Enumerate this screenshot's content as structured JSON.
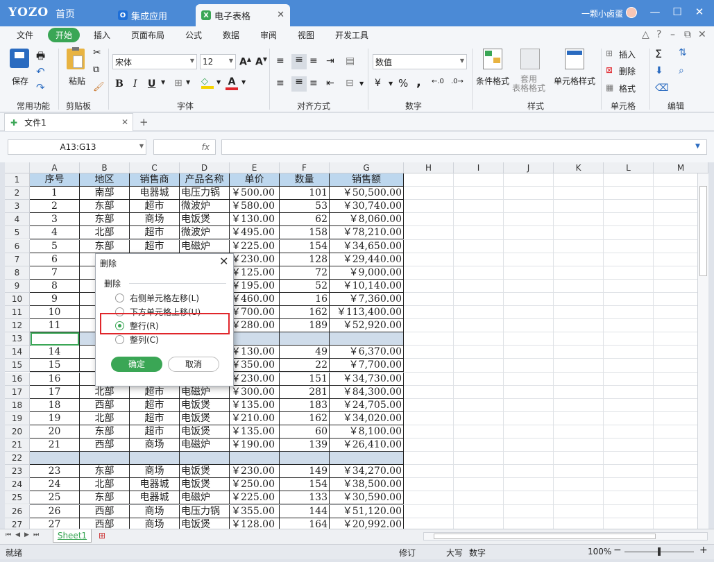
{
  "app": {
    "logo": "YOZO",
    "home": "首页",
    "tabs": [
      {
        "label": "集成应用",
        "icon": "O"
      },
      {
        "label": "电子表格",
        "icon": "X"
      }
    ],
    "user": "一颗小卤蛋"
  },
  "ribbon_tabs": [
    "文件",
    "开始",
    "插入",
    "页面布局",
    "公式",
    "数据",
    "审阅",
    "视图",
    "开发工具"
  ],
  "ribbon": {
    "save": "保存",
    "paste": "粘贴",
    "font_name": "宋体",
    "font_size": "12",
    "number_format": "数值",
    "cond_format": "条件格式",
    "table_format": "套用\n表格格式",
    "cell_style": "单元格样式",
    "insert": "插入",
    "delete": "删除",
    "format": "格式",
    "groups": [
      "常用功能",
      "剪贴板",
      "字体",
      "对齐方式",
      "数字",
      "样式",
      "单元格",
      "编辑"
    ],
    "bold": "B",
    "italic": "I",
    "underline": "U",
    "font_color_letter": "A",
    "currency": "¥",
    "percent": "%",
    "comma": ","
  },
  "doc_tab": "文件1",
  "formula_bar": {
    "name_box": "A13:G13",
    "fx": "fx",
    "content": ""
  },
  "columns": [
    "A",
    "B",
    "C",
    "D",
    "E",
    "F",
    "G",
    "H",
    "I",
    "J",
    "K",
    "L",
    "M"
  ],
  "headers": [
    "序号",
    "地区",
    "销售商",
    "产品名称",
    "单价",
    "数量",
    "销售额"
  ],
  "rows": [
    [
      "1",
      "南部",
      "电器城",
      "电压力锅",
      "￥500.00",
      "101",
      "￥50,500.00"
    ],
    [
      "2",
      "东部",
      "超市",
      "微波炉",
      "￥580.00",
      "53",
      "￥30,740.00"
    ],
    [
      "3",
      "东部",
      "商场",
      "电饭煲",
      "￥130.00",
      "62",
      "￥8,060.00"
    ],
    [
      "4",
      "北部",
      "超市",
      "微波炉",
      "￥495.00",
      "158",
      "￥78,210.00"
    ],
    [
      "5",
      "东部",
      "超市",
      "电磁炉",
      "￥225.00",
      "154",
      "￥34,650.00"
    ],
    [
      "6",
      "",
      "",
      "",
      "￥230.00",
      "128",
      "￥29,440.00"
    ],
    [
      "7",
      "",
      "",
      "",
      "￥125.00",
      "72",
      "￥9,000.00"
    ],
    [
      "8",
      "",
      "",
      "",
      "￥195.00",
      "52",
      "￥10,140.00"
    ],
    [
      "9",
      "",
      "",
      "",
      "￥460.00",
      "16",
      "￥7,360.00"
    ],
    [
      "10",
      "",
      "",
      "",
      "￥700.00",
      "162",
      "￥113,400.00"
    ],
    [
      "11",
      "",
      "",
      "",
      "￥280.00",
      "189",
      "￥52,920.00"
    ],
    [
      "",
      "",
      "",
      "",
      "",
      "",
      ""
    ],
    [
      "14",
      "",
      "",
      "",
      "￥130.00",
      "49",
      "￥6,370.00"
    ],
    [
      "15",
      "",
      "",
      "",
      "￥350.00",
      "22",
      "￥7,700.00"
    ],
    [
      "16",
      "",
      "",
      "",
      "￥230.00",
      "151",
      "￥34,730.00"
    ],
    [
      "17",
      "北部",
      "超市",
      "电磁炉",
      "￥300.00",
      "281",
      "￥84,300.00"
    ],
    [
      "18",
      "西部",
      "超市",
      "电饭煲",
      "￥135.00",
      "183",
      "￥24,705.00"
    ],
    [
      "19",
      "北部",
      "超市",
      "电饭煲",
      "￥210.00",
      "162",
      "￥34,020.00"
    ],
    [
      "20",
      "东部",
      "超市",
      "电饭煲",
      "￥135.00",
      "60",
      "￥8,100.00"
    ],
    [
      "21",
      "西部",
      "商场",
      "电磁炉",
      "￥190.00",
      "139",
      "￥26,410.00"
    ],
    [
      "",
      "",
      "",
      "",
      "",
      "",
      ""
    ],
    [
      "23",
      "东部",
      "商场",
      "电饭煲",
      "￥230.00",
      "149",
      "￥34,270.00"
    ],
    [
      "24",
      "北部",
      "电器城",
      "电饭煲",
      "￥250.00",
      "154",
      "￥38,500.00"
    ],
    [
      "25",
      "东部",
      "电器城",
      "电磁炉",
      "￥225.00",
      "133",
      "￥30,590.00"
    ],
    [
      "26",
      "西部",
      "商场",
      "电压力锅",
      "￥355.00",
      "144",
      "￥51,120.00"
    ],
    [
      "27",
      "西部",
      "商场",
      "电饭煲",
      "￥128.00",
      "164",
      "￥20,992.00"
    ]
  ],
  "dialog": {
    "title": "删除",
    "group": "删除",
    "options": [
      "右侧单元格左移(L)",
      "下方单元格上移(U)",
      "整行(R)",
      "整列(C)"
    ],
    "selected": 2,
    "ok": "确定",
    "cancel": "取消"
  },
  "sheet_tab": "Sheet1",
  "status": {
    "ready": "就绪",
    "revise": "修订",
    "caps": "大写",
    "num": "数字",
    "zoom": "100%"
  },
  "colors": {
    "accent": "#3aa655",
    "title_bar": "#4b8ad6",
    "highlight_box": "#e0262b",
    "selected_row": "#cfdcea",
    "header_fill": "#bdd7ee"
  }
}
